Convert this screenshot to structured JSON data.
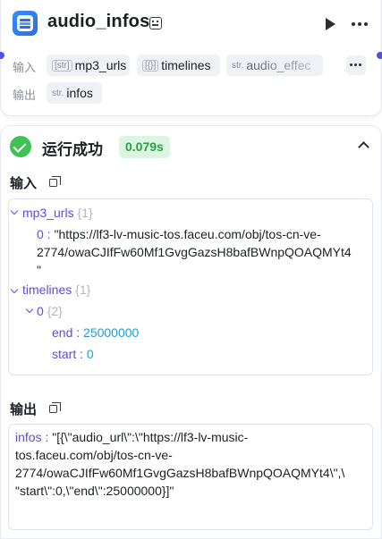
{
  "node": {
    "title": "audio_infos",
    "input_label": "输入",
    "output_label": "输出",
    "inputs": [
      {
        "type": "[str]",
        "name": "mp3_urls"
      },
      {
        "type": "[{}]",
        "name": "timelines"
      },
      {
        "type": "str.",
        "name": "audio_effec"
      }
    ],
    "outputs": [
      {
        "type": "str.",
        "name": "infos"
      }
    ]
  },
  "run": {
    "status": "运行成功",
    "duration": "0.079s",
    "input_title": "输入",
    "output_title": "输出",
    "input_json": {
      "mp3_urls_key": "mp3_urls",
      "mp3_urls_count": "{1}",
      "mp3_item_index": "0 :",
      "mp3_item_line1": "\"https://lf3-lv-music-tos.faceu.com/obj/tos-cn-ve-",
      "mp3_item_line2": "2774/owaCJIfFw60Mf1GvgGazsH8bafBWnpQOAQMYt4",
      "mp3_item_line3": "\"",
      "timelines_key": "timelines",
      "timelines_count": "{1}",
      "tl_item_index": "0",
      "tl_item_count": "{2}",
      "end_key": "end :",
      "end_value": "25000000",
      "start_key": "start :",
      "start_value": "0"
    },
    "output_json": {
      "infos_key": "infos :",
      "line1": "\"[{\\\"audio_url\\\":\\\"https://lf3-lv-music-",
      "line2": "tos.faceu.com/obj/tos-cn-ve-",
      "line3": "2774/owaCJIfFw60Mf1GvgGazsH8bafBWnpQOAQMYt4\\\",\\",
      "line4": "\"start\\\":0,\\\"end\\\":25000000}]\""
    }
  },
  "colors": {
    "accent": "#4d53e8",
    "success": "#3ec254",
    "key": "#5b4fd6",
    "number": "#1f9ecf"
  }
}
